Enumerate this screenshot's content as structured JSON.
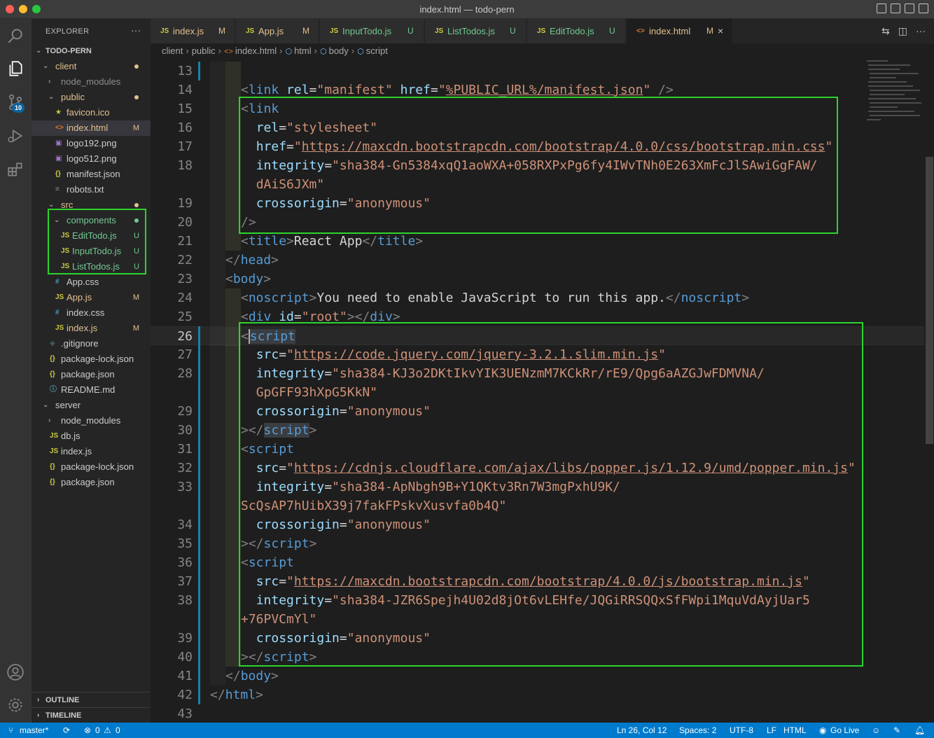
{
  "window": {
    "title": "index.html — todo-pern"
  },
  "activity": {
    "scm_badge": "10"
  },
  "sidebar": {
    "header": "EXPLORER",
    "more": "···",
    "root": "TODO-PERN",
    "items": [
      {
        "label": "client",
        "kind": "folder-open",
        "color": "#e2c08d"
      },
      {
        "label": "node_modules",
        "kind": "folder",
        "color": "#8c8c8c"
      },
      {
        "label": "public",
        "kind": "folder-open",
        "color": "#e2c08d"
      },
      {
        "label": "favicon.ico",
        "icon": "★",
        "color": "#e2c08d"
      },
      {
        "label": "index.html",
        "icon": "<>",
        "status": "M",
        "color": "#e2c08d"
      },
      {
        "label": "logo192.png",
        "icon": "▣",
        "color": "#cccccc"
      },
      {
        "label": "logo512.png",
        "icon": "▣",
        "color": "#cccccc"
      },
      {
        "label": "manifest.json",
        "icon": "{}",
        "color": "#cccccc"
      },
      {
        "label": "robots.txt",
        "icon": "≡",
        "color": "#cccccc"
      },
      {
        "label": "src",
        "kind": "folder-open",
        "color": "#e2c08d"
      },
      {
        "label": "components",
        "kind": "folder-open",
        "color": "#73c991"
      },
      {
        "label": "EditTodo.js",
        "icon": "JS",
        "status": "U",
        "color": "#73c991"
      },
      {
        "label": "InputTodo.js",
        "icon": "JS",
        "status": "U",
        "color": "#73c991"
      },
      {
        "label": "ListTodos.js",
        "icon": "JS",
        "status": "U",
        "color": "#73c991"
      },
      {
        "label": "App.css",
        "icon": "#",
        "color": "#cccccc"
      },
      {
        "label": "App.js",
        "icon": "JS",
        "status": "M",
        "color": "#e2c08d"
      },
      {
        "label": "index.css",
        "icon": "#",
        "color": "#cccccc"
      },
      {
        "label": "index.js",
        "icon": "JS",
        "status": "M",
        "color": "#e2c08d"
      },
      {
        "label": ".gitignore",
        "icon": "◆",
        "color": "#cccccc"
      },
      {
        "label": "package-lock.json",
        "icon": "{}",
        "color": "#cccccc"
      },
      {
        "label": "package.json",
        "icon": "{}",
        "color": "#cccccc"
      },
      {
        "label": "README.md",
        "icon": "ⓘ",
        "color": "#cccccc"
      },
      {
        "label": "server",
        "kind": "folder-open",
        "color": "#cccccc"
      },
      {
        "label": "node_modules",
        "kind": "folder",
        "color": "#cccccc"
      },
      {
        "label": "db.js",
        "icon": "JS",
        "color": "#cccccc"
      },
      {
        "label": "index.js",
        "icon": "JS",
        "color": "#cccccc"
      },
      {
        "label": "package-lock.json",
        "icon": "{}",
        "color": "#cccccc"
      },
      {
        "label": "package.json",
        "icon": "{}",
        "color": "#cccccc"
      }
    ],
    "outline": "OUTLINE",
    "timeline": "TIMELINE"
  },
  "tabs": [
    {
      "label": "index.js",
      "status": "M"
    },
    {
      "label": "App.js",
      "status": "M"
    },
    {
      "label": "InputTodo.js",
      "status": "U"
    },
    {
      "label": "ListTodos.js",
      "status": "U"
    },
    {
      "label": "EditTodo.js",
      "status": "U"
    },
    {
      "label": "index.html",
      "status": "M",
      "close": "×"
    }
  ],
  "breadcrumbs": [
    "client",
    "public",
    "index.html",
    "html",
    "body",
    "script"
  ],
  "editor": {
    "lines": [
      {
        "n": "13",
        "segs": []
      },
      {
        "n": "14",
        "segs": [
          [
            "punc",
            "<"
          ],
          [
            "tag",
            "link"
          ],
          [
            "txt",
            " "
          ],
          [
            "attr",
            "rel"
          ],
          [
            "txt",
            "="
          ],
          [
            "str",
            "\"manifest\""
          ],
          [
            "txt",
            " "
          ],
          [
            "attr",
            "href"
          ],
          [
            "txt",
            "="
          ],
          [
            "str",
            "\""
          ],
          [
            "url",
            "%PUBLIC_URL%/manifest.json"
          ],
          [
            "str",
            "\""
          ],
          [
            "txt",
            " "
          ],
          [
            "punc",
            "/>"
          ]
        ]
      },
      {
        "n": "15",
        "segs": [
          [
            "punc",
            "<"
          ],
          [
            "tag",
            "link"
          ]
        ]
      },
      {
        "n": "16",
        "segs": [
          [
            "txt",
            "  "
          ],
          [
            "attr",
            "rel"
          ],
          [
            "txt",
            "="
          ],
          [
            "str",
            "\"stylesheet\""
          ]
        ]
      },
      {
        "n": "17",
        "segs": [
          [
            "txt",
            "  "
          ],
          [
            "attr",
            "href"
          ],
          [
            "txt",
            "="
          ],
          [
            "str",
            "\""
          ],
          [
            "url",
            "https://maxcdn.bootstrapcdn.com/bootstrap/4.0.0/css/bootstrap.min.css"
          ],
          [
            "str",
            "\""
          ]
        ]
      },
      {
        "n": "18",
        "segs": [
          [
            "txt",
            "  "
          ],
          [
            "attr",
            "integrity"
          ],
          [
            "txt",
            "="
          ],
          [
            "str",
            "\"sha384-Gn5384xqQ1aoWXA+058RXPxPg6fy4IWvTNh0E263XmFcJlSAwiGgFAW/"
          ]
        ]
      },
      {
        "n": "",
        "segs": [
          [
            "txt",
            "  "
          ],
          [
            "str",
            "dAiS6JXm\""
          ]
        ]
      },
      {
        "n": "19",
        "segs": [
          [
            "txt",
            "  "
          ],
          [
            "attr",
            "crossorigin"
          ],
          [
            "txt",
            "="
          ],
          [
            "str",
            "\"anonymous\""
          ]
        ]
      },
      {
        "n": "20",
        "segs": [
          [
            "punc",
            "/>"
          ]
        ]
      },
      {
        "n": "21",
        "segs": [
          [
            "punc",
            "<"
          ],
          [
            "tag",
            "title"
          ],
          [
            "punc",
            ">"
          ],
          [
            "txt",
            "React App"
          ],
          [
            "punc",
            "</"
          ],
          [
            "tag",
            "title"
          ],
          [
            "punc",
            ">"
          ]
        ]
      },
      {
        "n": "22",
        "segs": [
          [
            "punc",
            "</"
          ],
          [
            "tag",
            "head"
          ],
          [
            "punc",
            ">"
          ]
        ],
        "indent": 1
      },
      {
        "n": "23",
        "segs": [
          [
            "punc",
            "<"
          ],
          [
            "tag",
            "body"
          ],
          [
            "punc",
            ">"
          ]
        ],
        "indent": 1
      },
      {
        "n": "24",
        "segs": [
          [
            "punc",
            "<"
          ],
          [
            "tag",
            "noscript"
          ],
          [
            "punc",
            ">"
          ],
          [
            "txt",
            "You need to enable JavaScript to run this app."
          ],
          [
            "punc",
            "</"
          ],
          [
            "tag",
            "noscript"
          ],
          [
            "punc",
            ">"
          ]
        ]
      },
      {
        "n": "25",
        "segs": [
          [
            "punc",
            "<"
          ],
          [
            "tag",
            "div"
          ],
          [
            "txt",
            " "
          ],
          [
            "attr",
            "id"
          ],
          [
            "txt",
            "="
          ],
          [
            "str",
            "\"root\""
          ],
          [
            "punc",
            "></"
          ],
          [
            "tag",
            "div"
          ],
          [
            "punc",
            ">"
          ]
        ]
      },
      {
        "n": "26",
        "segs": [
          [
            "punc",
            "<"
          ],
          [
            "taghl",
            "script"
          ]
        ],
        "current": true
      },
      {
        "n": "27",
        "segs": [
          [
            "txt",
            "  "
          ],
          [
            "attr",
            "src"
          ],
          [
            "txt",
            "="
          ],
          [
            "str",
            "\""
          ],
          [
            "url",
            "https://code.jquery.com/jquery-3.2.1.slim.min.js"
          ],
          [
            "str",
            "\""
          ]
        ]
      },
      {
        "n": "28",
        "segs": [
          [
            "txt",
            "  "
          ],
          [
            "attr",
            "integrity"
          ],
          [
            "txt",
            "="
          ],
          [
            "str",
            "\"sha384-KJ3o2DKtIkvYIK3UENzmM7KCkRr/rE9/Qpg6aAZGJwFDMVNA/"
          ]
        ]
      },
      {
        "n": "",
        "segs": [
          [
            "txt",
            "  "
          ],
          [
            "str",
            "GpGFF93hXpG5KkN\""
          ]
        ]
      },
      {
        "n": "29",
        "segs": [
          [
            "txt",
            "  "
          ],
          [
            "attr",
            "crossorigin"
          ],
          [
            "txt",
            "="
          ],
          [
            "str",
            "\"anonymous\""
          ]
        ]
      },
      {
        "n": "30",
        "segs": [
          [
            "punc",
            "></"
          ],
          [
            "taghl",
            "script"
          ],
          [
            "punc",
            ">"
          ]
        ]
      },
      {
        "n": "31",
        "segs": [
          [
            "punc",
            "<"
          ],
          [
            "tag",
            "script"
          ]
        ]
      },
      {
        "n": "32",
        "segs": [
          [
            "txt",
            "  "
          ],
          [
            "attr",
            "src"
          ],
          [
            "txt",
            "="
          ],
          [
            "str",
            "\""
          ],
          [
            "url",
            "https://cdnjs.cloudflare.com/ajax/libs/popper.js/1.12.9/umd/popper.min.js"
          ],
          [
            "str",
            "\""
          ]
        ]
      },
      {
        "n": "33",
        "segs": [
          [
            "txt",
            "  "
          ],
          [
            "attr",
            "integrity"
          ],
          [
            "txt",
            "="
          ],
          [
            "str",
            "\"sha384-ApNbgh9B+Y1QKtv3Rn7W3mgPxhU9K/"
          ]
        ]
      },
      {
        "n": "",
        "segs": [
          [
            "str",
            "ScQsAP7hUibX39j7fakFPskvXusvfa0b4Q\""
          ]
        ]
      },
      {
        "n": "34",
        "segs": [
          [
            "txt",
            "  "
          ],
          [
            "attr",
            "crossorigin"
          ],
          [
            "txt",
            "="
          ],
          [
            "str",
            "\"anonymous\""
          ]
        ]
      },
      {
        "n": "35",
        "segs": [
          [
            "punc",
            "></"
          ],
          [
            "tag",
            "script"
          ],
          [
            "punc",
            ">"
          ]
        ]
      },
      {
        "n": "36",
        "segs": [
          [
            "punc",
            "<"
          ],
          [
            "tag",
            "script"
          ]
        ]
      },
      {
        "n": "37",
        "segs": [
          [
            "txt",
            "  "
          ],
          [
            "attr",
            "src"
          ],
          [
            "txt",
            "="
          ],
          [
            "str",
            "\""
          ],
          [
            "url",
            "https://maxcdn.bootstrapcdn.com/bootstrap/4.0.0/js/bootstrap.min.js"
          ],
          [
            "str",
            "\""
          ]
        ]
      },
      {
        "n": "38",
        "segs": [
          [
            "txt",
            "  "
          ],
          [
            "attr",
            "integrity"
          ],
          [
            "txt",
            "="
          ],
          [
            "str",
            "\"sha384-JZR6Spejh4U02d8jOt6vLEHfe/JQGiRRSQQxSfFWpi1MquVdAyjUar5"
          ]
        ]
      },
      {
        "n": "",
        "segs": [
          [
            "str",
            "+76PVCmYl\""
          ]
        ]
      },
      {
        "n": "39",
        "segs": [
          [
            "txt",
            "  "
          ],
          [
            "attr",
            "crossorigin"
          ],
          [
            "txt",
            "="
          ],
          [
            "str",
            "\"anonymous\""
          ]
        ]
      },
      {
        "n": "40",
        "segs": [
          [
            "punc",
            "></"
          ],
          [
            "tag",
            "script"
          ],
          [
            "punc",
            ">"
          ]
        ]
      },
      {
        "n": "41",
        "segs": [
          [
            "punc",
            "</"
          ],
          [
            "tag",
            "body"
          ],
          [
            "punc",
            ">"
          ]
        ],
        "indent": 1
      },
      {
        "n": "42",
        "segs": [
          [
            "punc",
            "</"
          ],
          [
            "tag",
            "html"
          ],
          [
            "punc",
            ">"
          ]
        ],
        "indent": 0
      },
      {
        "n": "43",
        "segs": [],
        "indent": 0
      }
    ]
  },
  "status": {
    "branch": "master*",
    "errors": "0",
    "warnings": "0",
    "position": "Ln 26, Col 12",
    "spaces": "Spaces: 2",
    "encoding": "UTF-8",
    "eol": "LF",
    "language": "HTML",
    "golive": "Go Live"
  }
}
